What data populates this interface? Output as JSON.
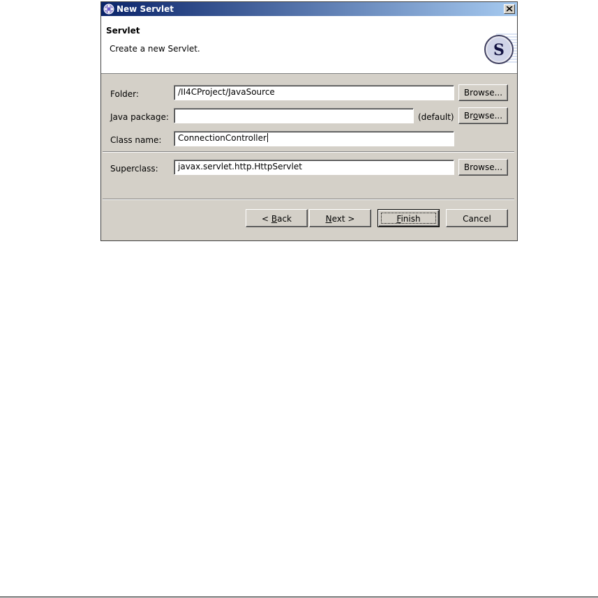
{
  "window": {
    "title": "New Servlet"
  },
  "banner": {
    "title": "Servlet",
    "description": "Create a new Servlet."
  },
  "form": {
    "folder": {
      "label": "Folder:",
      "value": "/II4CProject/JavaSource",
      "browse": "Browse..."
    },
    "package": {
      "label_ul": "J",
      "label_rest": "ava package:",
      "value": "",
      "default_hint": "(default)",
      "browse_pre": "Br",
      "browse_ul": "o",
      "browse_post": "wse..."
    },
    "class_name": {
      "label": "Class name:",
      "value": "ConnectionController"
    },
    "superclass": {
      "label": "Superclass:",
      "value": "javax.servlet.http.HttpServlet",
      "browse": "Browse..."
    }
  },
  "buttons": {
    "back": {
      "pre": "< ",
      "ul": "B",
      "post": "ack"
    },
    "next": {
      "ul": "N",
      "post": "ext >"
    },
    "finish": {
      "ul": "F",
      "post": "inish"
    },
    "cancel": "Cancel"
  },
  "colors": {
    "title_start": "#0a246a",
    "title_end": "#a6caf0",
    "dialog_bg": "#d4d0c8"
  }
}
